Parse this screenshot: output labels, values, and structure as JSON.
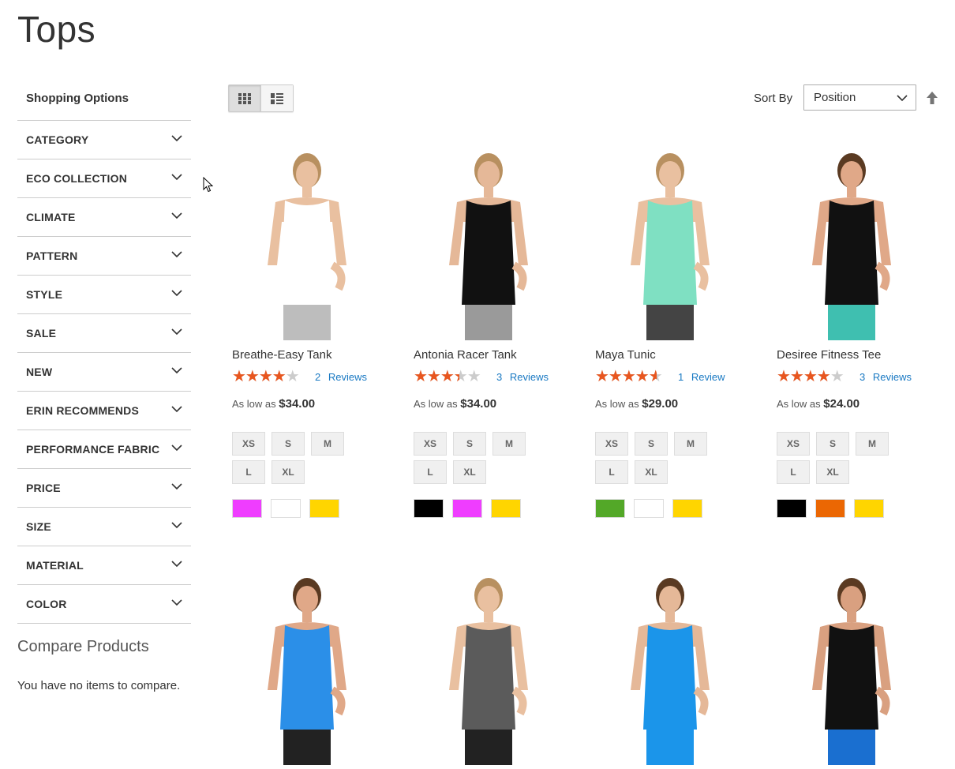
{
  "page": {
    "title": "Tops"
  },
  "sidebar": {
    "heading": "Shopping Options",
    "filters": [
      {
        "label": "Category"
      },
      {
        "label": "Eco Collection"
      },
      {
        "label": "Climate"
      },
      {
        "label": "Pattern"
      },
      {
        "label": "Style"
      },
      {
        "label": "Sale"
      },
      {
        "label": "New"
      },
      {
        "label": "Erin Recommends"
      },
      {
        "label": "Performance Fabric"
      },
      {
        "label": "Price"
      },
      {
        "label": "Size"
      },
      {
        "label": "Material"
      },
      {
        "label": "Color"
      }
    ]
  },
  "compare": {
    "title": "Compare Products",
    "empty_text": "You have no items to compare."
  },
  "toolbar": {
    "sort_label": "Sort By",
    "sort_value": "Position",
    "view_modes": [
      "grid",
      "list"
    ],
    "active_mode": "grid"
  },
  "products": [
    {
      "name": "Breathe-Easy Tank",
      "rating": 0.7,
      "reviews": "2  Reviews",
      "price_prefix": "As low as",
      "price": "$34.00",
      "sizes": [
        "XS",
        "S",
        "M",
        "L",
        "XL"
      ],
      "colors": [
        "#ef3dff",
        "#ffffff",
        "#ffd500"
      ]
    },
    {
      "name": "Antonia Racer Tank",
      "rating": 0.6,
      "reviews": "3  Reviews",
      "price_prefix": "As low as",
      "price": "$34.00",
      "sizes": [
        "XS",
        "S",
        "M",
        "L",
        "XL"
      ],
      "colors": [
        "#000000",
        "#ef3dff",
        "#ffd500"
      ]
    },
    {
      "name": "Maya Tunic",
      "rating": 0.8,
      "reviews": "1  Review",
      "price_prefix": "As low as",
      "price": "$29.00",
      "sizes": [
        "XS",
        "S",
        "M",
        "L",
        "XL"
      ],
      "colors": [
        "#53a828",
        "#ffffff",
        "#ffd500"
      ]
    },
    {
      "name": "Desiree Fitness Tee",
      "rating": 0.7,
      "reviews": "3  Reviews",
      "price_prefix": "As low as",
      "price": "$24.00",
      "sizes": [
        "XS",
        "S",
        "M",
        "L",
        "XL"
      ],
      "colors": [
        "#000000",
        "#eb6703",
        "#ffd500"
      ]
    }
  ],
  "products_row2": [
    {
      "top": "blue-quarter-zip"
    },
    {
      "top": "grey-hoodie"
    },
    {
      "top": "blue-tank"
    },
    {
      "top": "black-tee"
    }
  ]
}
